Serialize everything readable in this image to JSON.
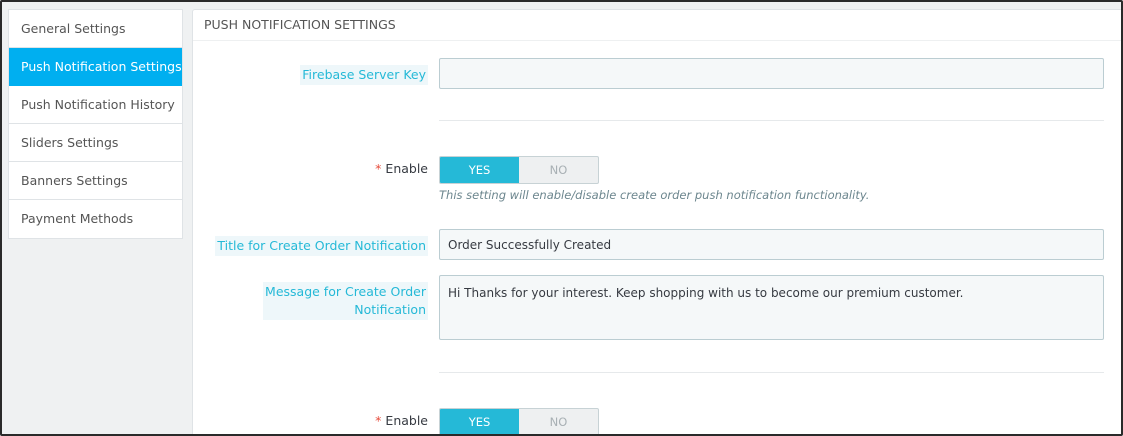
{
  "sidebar": {
    "items": [
      {
        "label": "General Settings",
        "active": false
      },
      {
        "label": "Push Notification Settings",
        "active": true
      },
      {
        "label": "Push Notification History",
        "active": false
      },
      {
        "label": "Sliders Settings",
        "active": false
      },
      {
        "label": "Banners Settings",
        "active": false
      },
      {
        "label": "Payment Methods",
        "active": false
      }
    ]
  },
  "panel": {
    "heading": "PUSH NOTIFICATION SETTINGS",
    "firebase_label": "Firebase Server Key",
    "firebase_value": "",
    "enable_required_mark": "*",
    "enable_label": "Enable",
    "enable_yes": "YES",
    "enable_no": "NO",
    "enable_help": "This setting will enable/disable create order push notification functionality.",
    "title_label": "Title for Create Order Notification",
    "title_value": "Order Successfully Created",
    "message_label_line1": "Message for Create Order",
    "message_label_line2": "Notification",
    "message_value": "Hi Thanks for your interest. Keep shopping with us to become our premium customer.",
    "enable2_required_mark": "*",
    "enable2_label": "Enable",
    "enable2_yes": "YES",
    "enable2_no": "NO"
  },
  "colors": {
    "accent": "#25b9d7",
    "sidebar_active": "#00aff0",
    "required": "#e64b3b"
  }
}
